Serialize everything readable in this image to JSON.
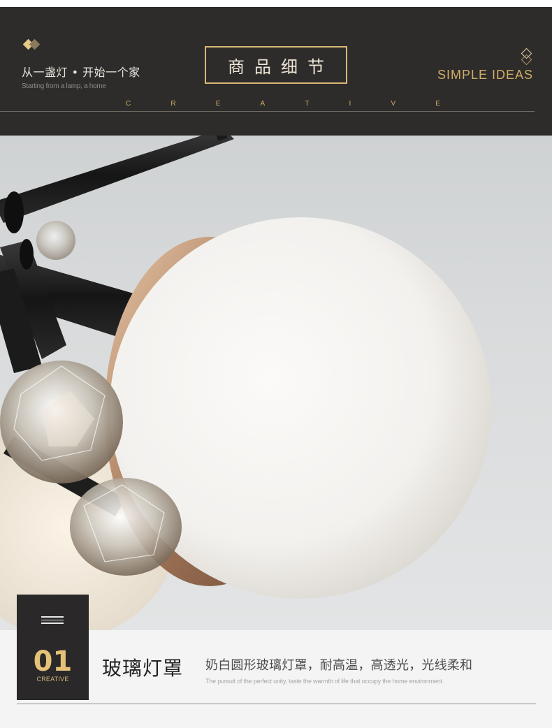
{
  "header": {
    "slogan_cn": "从一盏灯 • 开始一个家",
    "slogan_en": "Starting from a lamp, a home",
    "title": "商品细节",
    "brand_tagline": "SIMPLE IDEAS",
    "creative_letters": [
      "C",
      "R",
      "E",
      "A",
      "T",
      "I",
      "V",
      "E"
    ],
    "accent_color": "#cfad66",
    "background_color": "#2e2c2b"
  },
  "photo": {
    "subject": "lamp-detail-photo"
  },
  "feature": {
    "number": "01",
    "caption": "CREATIVE",
    "title": "玻璃灯罩",
    "description": "奶白圆形玻璃灯罩，耐高温，高透光，光线柔和",
    "description_en": "The pursuit of the perfect unity, taste the warmth of life that occupy the home environment."
  },
  "icons": {
    "left_header_icon": "gold-diamond-pair-icon",
    "right_header_icon": "outline-diamond-stack-icon",
    "badge_icon": "menu-lines-icon"
  }
}
